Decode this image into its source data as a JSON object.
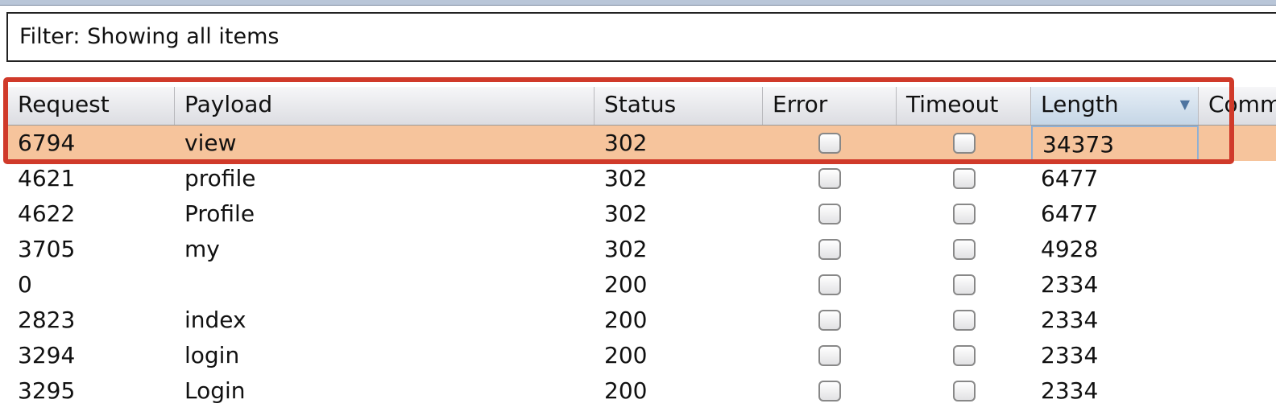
{
  "filter": {
    "label": "Filter: Showing all items"
  },
  "columns": [
    "Request",
    "Payload",
    "Status",
    "Error",
    "Timeout",
    "Length",
    "Comment"
  ],
  "sort": {
    "column": "Length",
    "direction": "descending",
    "icon": "sort-down-triangle"
  },
  "rows": [
    {
      "request": "6794",
      "payload": "view",
      "status": "302",
      "error": false,
      "timeout": false,
      "length": "34373",
      "selected": true
    },
    {
      "request": "4621",
      "payload": "profile",
      "status": "302",
      "error": false,
      "timeout": false,
      "length": "6477"
    },
    {
      "request": "4622",
      "payload": "Profile",
      "status": "302",
      "error": false,
      "timeout": false,
      "length": "6477"
    },
    {
      "request": "3705",
      "payload": "my",
      "status": "302",
      "error": false,
      "timeout": false,
      "length": "4928"
    },
    {
      "request": "0",
      "payload": "",
      "status": "200",
      "error": false,
      "timeout": false,
      "length": "2334"
    },
    {
      "request": "2823",
      "payload": "index",
      "status": "200",
      "error": false,
      "timeout": false,
      "length": "2334"
    },
    {
      "request": "3294",
      "payload": "login",
      "status": "200",
      "error": false,
      "timeout": false,
      "length": "2334"
    },
    {
      "request": "3295",
      "payload": "Login",
      "status": "200",
      "error": false,
      "timeout": false,
      "length": "2334"
    }
  ],
  "colors": {
    "selected_row": "#f6c49c",
    "highlight_box": "#d03a2a"
  }
}
